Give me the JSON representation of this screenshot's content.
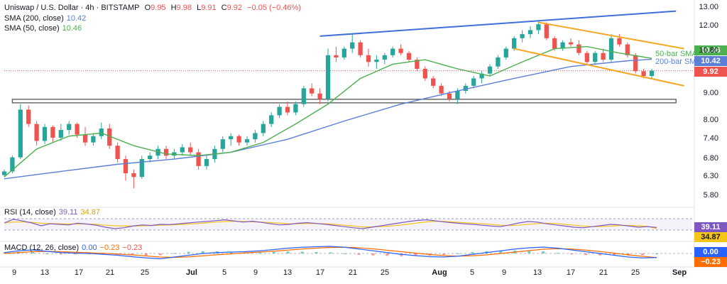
{
  "header": {
    "symbol": "Uniswap / U.S. Dollar · 4h · BITSTAMP",
    "o_label": "O",
    "o": "9.95",
    "h_label": "H",
    "h": "9.98",
    "l_label": "L",
    "l": "9.91",
    "c_label": "C",
    "c": "9.92",
    "change": "−0.05 (−0.46%)"
  },
  "indicators": {
    "sma200_label": "SMA (200, close)",
    "sma200_value": "10.42",
    "sma50_label": "SMA (50, close)",
    "sma50_value": "10.46",
    "rsi_label": "RSI (14, close)",
    "rsi_value": "39.11",
    "rsi_ma_value": "34.87",
    "macd_label": "MACD (12, 26, close)",
    "macd_value": "0.00",
    "macd_signal": "−0.23",
    "macd_hist": "−0.23"
  },
  "annotations": {
    "sma50_text": "50-bar SMA",
    "sma200_text": "200-bar SMA"
  },
  "price_tags": {
    "sma50": "10.46",
    "sma200": "10.42",
    "last": "9.92",
    "rsi": "39.11",
    "rsi_ma": "34.87",
    "macd": "0.00",
    "signal": "−0.23"
  },
  "colors": {
    "up": "#26a69a",
    "down": "#ef5350",
    "sma50": "#4caf50",
    "sma200": "#5b7fd6",
    "trend": "#3f6fd8",
    "channel": "#f5a623",
    "support": "#555555",
    "rsi": "#7e57c2",
    "rsi_ma": "#f5c518",
    "macd": "#2962ff",
    "signal": "#ff6d00"
  },
  "chart_data": {
    "type": "candlestick",
    "y_ticks": [
      "13.00",
      "12.00",
      "10.80",
      "9.00",
      "8.00",
      "7.40",
      "6.80",
      "6.30",
      "5.80"
    ],
    "y_axis": {
      "scale": "log",
      "range": [
        5.6,
        13.1
      ]
    },
    "x_ticks": [
      "9",
      "13",
      "17",
      "21",
      "25",
      "Jul",
      "5",
      "9",
      "13",
      "17",
      "21",
      "25",
      "Aug",
      "5",
      "9",
      "13",
      "17",
      "21",
      "25",
      "Sep"
    ],
    "x_axis": {
      "from": "2024-06-08",
      "to": "2024-09-01"
    },
    "candles": [
      [
        "2024-06-08",
        6.35,
        6.5,
        6.3,
        6.45
      ],
      [
        "2024-06-09",
        6.45,
        6.9,
        6.4,
        6.85
      ],
      [
        "2024-06-10",
        6.85,
        8.6,
        6.8,
        8.4
      ],
      [
        "2024-06-11",
        8.4,
        8.55,
        7.8,
        7.9
      ],
      [
        "2024-06-12",
        7.9,
        8.0,
        7.2,
        7.35
      ],
      [
        "2024-06-13",
        7.35,
        7.9,
        7.25,
        7.8
      ],
      [
        "2024-06-14",
        7.8,
        7.85,
        7.3,
        7.45
      ],
      [
        "2024-06-15",
        7.45,
        7.9,
        7.35,
        7.7
      ],
      [
        "2024-06-16",
        7.7,
        8.0,
        7.55,
        7.9
      ],
      [
        "2024-06-17",
        7.9,
        7.95,
        7.45,
        7.55
      ],
      [
        "2024-06-18",
        7.55,
        7.8,
        7.2,
        7.3
      ],
      [
        "2024-06-19",
        7.3,
        7.6,
        7.2,
        7.5
      ],
      [
        "2024-06-20",
        7.5,
        7.95,
        7.4,
        7.75
      ],
      [
        "2024-06-21",
        7.75,
        7.9,
        7.1,
        7.2
      ],
      [
        "2024-06-22",
        7.2,
        7.3,
        6.7,
        6.8
      ],
      [
        "2024-06-23",
        6.8,
        6.9,
        6.2,
        6.4
      ],
      [
        "2024-06-24",
        6.4,
        6.5,
        6.0,
        6.3
      ],
      [
        "2024-06-25",
        6.3,
        6.9,
        6.25,
        6.8
      ],
      [
        "2024-06-26",
        6.8,
        7.0,
        6.7,
        6.9
      ],
      [
        "2024-06-27",
        6.9,
        7.2,
        6.8,
        7.1
      ],
      [
        "2024-06-28",
        7.1,
        7.2,
        6.8,
        6.9
      ],
      [
        "2024-06-29",
        6.9,
        7.1,
        6.8,
        7.0
      ],
      [
        "2024-06-30",
        7.0,
        7.25,
        6.9,
        7.15
      ],
      [
        "2024-07-01",
        7.15,
        7.3,
        6.9,
        7.0
      ],
      [
        "2024-07-02",
        7.0,
        7.1,
        6.5,
        6.6
      ],
      [
        "2024-07-03",
        6.6,
        6.9,
        6.5,
        6.8
      ],
      [
        "2024-07-04",
        6.8,
        7.2,
        6.7,
        7.1
      ],
      [
        "2024-07-05",
        7.1,
        7.5,
        7.0,
        7.4
      ],
      [
        "2024-07-06",
        7.4,
        7.6,
        7.2,
        7.5
      ],
      [
        "2024-07-07",
        7.5,
        7.55,
        7.2,
        7.3
      ],
      [
        "2024-07-08",
        7.3,
        7.5,
        7.2,
        7.4
      ],
      [
        "2024-07-09",
        7.4,
        7.7,
        7.3,
        7.6
      ],
      [
        "2024-07-10",
        7.6,
        8.0,
        7.5,
        7.9
      ],
      [
        "2024-07-11",
        7.9,
        8.3,
        7.8,
        8.2
      ],
      [
        "2024-07-12",
        8.2,
        8.6,
        8.1,
        8.5
      ],
      [
        "2024-07-13",
        8.5,
        8.7,
        8.2,
        8.3
      ],
      [
        "2024-07-14",
        8.3,
        8.7,
        8.2,
        8.6
      ],
      [
        "2024-07-15",
        8.6,
        9.3,
        8.5,
        9.2
      ],
      [
        "2024-07-16",
        9.2,
        9.4,
        8.9,
        9.0
      ],
      [
        "2024-07-17",
        9.0,
        9.2,
        8.6,
        8.8
      ],
      [
        "2024-07-18",
        8.8,
        10.9,
        8.7,
        10.6
      ],
      [
        "2024-07-19",
        10.6,
        11.0,
        10.3,
        10.5
      ],
      [
        "2024-07-20",
        10.5,
        11.0,
        10.4,
        10.9
      ],
      [
        "2024-07-21",
        10.9,
        11.6,
        10.7,
        11.2
      ],
      [
        "2024-07-22",
        11.2,
        11.3,
        10.5,
        10.6
      ],
      [
        "2024-07-23",
        10.6,
        10.9,
        10.1,
        10.3
      ],
      [
        "2024-07-24",
        10.3,
        10.6,
        10.0,
        10.4
      ],
      [
        "2024-07-25",
        10.4,
        10.7,
        10.2,
        10.6
      ],
      [
        "2024-07-26",
        10.6,
        11.0,
        10.5,
        10.9
      ],
      [
        "2024-07-27",
        10.9,
        11.1,
        10.6,
        10.7
      ],
      [
        "2024-07-28",
        10.7,
        10.8,
        10.3,
        10.4
      ],
      [
        "2024-07-29",
        10.4,
        10.5,
        9.9,
        10.0
      ],
      [
        "2024-07-30",
        10.0,
        10.1,
        9.5,
        9.6
      ],
      [
        "2024-07-31",
        9.6,
        9.7,
        9.2,
        9.3
      ],
      [
        "2024-08-01",
        9.3,
        9.4,
        8.9,
        9.0
      ],
      [
        "2024-08-02",
        9.0,
        9.1,
        8.7,
        8.8
      ],
      [
        "2024-08-03",
        8.8,
        9.2,
        8.6,
        9.1
      ],
      [
        "2024-08-04",
        9.1,
        9.4,
        9.0,
        9.3
      ],
      [
        "2024-08-05",
        9.3,
        9.7,
        9.2,
        9.6
      ],
      [
        "2024-08-06",
        9.6,
        9.9,
        9.4,
        9.8
      ],
      [
        "2024-08-07",
        9.8,
        10.2,
        9.7,
        10.1
      ],
      [
        "2024-08-08",
        10.1,
        10.6,
        10.0,
        10.5
      ],
      [
        "2024-08-09",
        10.5,
        11.0,
        10.4,
        10.9
      ],
      [
        "2024-08-10",
        10.9,
        11.5,
        10.8,
        11.4
      ],
      [
        "2024-08-11",
        11.4,
        11.8,
        11.2,
        11.6
      ],
      [
        "2024-08-12",
        11.6,
        12.0,
        11.4,
        11.8
      ],
      [
        "2024-08-13",
        11.8,
        12.3,
        11.6,
        12.1
      ],
      [
        "2024-08-14",
        12.1,
        12.2,
        11.3,
        11.4
      ],
      [
        "2024-08-15",
        11.4,
        11.5,
        10.8,
        10.9
      ],
      [
        "2024-08-16",
        10.9,
        11.3,
        10.8,
        11.2
      ],
      [
        "2024-08-17",
        11.2,
        11.4,
        11.0,
        11.1
      ],
      [
        "2024-08-18",
        11.1,
        11.3,
        10.6,
        10.7
      ],
      [
        "2024-08-19",
        10.7,
        10.8,
        10.2,
        10.3
      ],
      [
        "2024-08-20",
        10.3,
        10.8,
        10.2,
        10.7
      ],
      [
        "2024-08-21",
        10.7,
        10.9,
        10.3,
        10.4
      ],
      [
        "2024-08-22",
        10.4,
        11.6,
        10.3,
        11.4
      ],
      [
        "2024-08-23",
        11.4,
        11.6,
        11.0,
        11.1
      ],
      [
        "2024-08-24",
        11.1,
        11.2,
        10.5,
        10.6
      ],
      [
        "2024-08-25",
        10.6,
        10.7,
        9.8,
        9.9
      ],
      [
        "2024-08-26",
        9.9,
        10.0,
        9.6,
        9.7
      ],
      [
        "2024-08-27",
        9.7,
        10.0,
        9.6,
        9.92
      ]
    ],
    "sma50": [
      [
        "2024-06-08",
        6.3
      ],
      [
        "2024-06-12",
        7.1
      ],
      [
        "2024-06-16",
        7.5
      ],
      [
        "2024-06-20",
        7.6
      ],
      [
        "2024-06-24",
        7.2
      ],
      [
        "2024-06-28",
        6.95
      ],
      [
        "2024-07-02",
        6.9
      ],
      [
        "2024-07-06",
        7.0
      ],
      [
        "2024-07-10",
        7.3
      ],
      [
        "2024-07-14",
        7.9
      ],
      [
        "2024-07-18",
        8.6
      ],
      [
        "2024-07-22",
        9.6
      ],
      [
        "2024-07-26",
        10.2
      ],
      [
        "2024-07-30",
        10.4
      ],
      [
        "2024-08-03",
        10.0
      ],
      [
        "2024-08-07",
        9.7
      ],
      [
        "2024-08-11",
        10.3
      ],
      [
        "2024-08-15",
        10.9
      ],
      [
        "2024-08-19",
        11.0
      ],
      [
        "2024-08-23",
        10.7
      ],
      [
        "2024-08-27",
        10.46
      ]
    ],
    "sma200": [
      [
        "2024-06-08",
        6.25
      ],
      [
        "2024-06-15",
        6.45
      ],
      [
        "2024-06-22",
        6.65
      ],
      [
        "2024-06-29",
        6.8
      ],
      [
        "2024-07-06",
        7.0
      ],
      [
        "2024-07-13",
        7.4
      ],
      [
        "2024-07-20",
        8.0
      ],
      [
        "2024-07-27",
        8.6
      ],
      [
        "2024-08-03",
        9.1
      ],
      [
        "2024-08-10",
        9.6
      ],
      [
        "2024-08-17",
        10.1
      ],
      [
        "2024-08-24",
        10.35
      ],
      [
        "2024-08-27",
        10.42
      ]
    ],
    "trendlines": [
      {
        "kind": "resistance",
        "from": [
          "2024-07-17",
          11.5
        ],
        "to": [
          "2024-08-30",
          12.8
        ]
      },
      {
        "kind": "channel-top",
        "from": [
          "2024-08-13",
          12.2
        ],
        "to": [
          "2024-08-31",
          10.9
        ]
      },
      {
        "kind": "channel-bottom",
        "from": [
          "2024-08-10",
          10.9
        ],
        "to": [
          "2024-08-31",
          9.3
        ]
      },
      {
        "kind": "support",
        "from": [
          "2024-06-09",
          8.7
        ],
        "to": [
          "2024-08-30",
          8.7
        ]
      }
    ],
    "rsi": {
      "range": [
        0,
        100
      ],
      "levels": [
        70,
        30
      ],
      "values": [
        55,
        68,
        62,
        55,
        45,
        52,
        50,
        48,
        54,
        51,
        47,
        40,
        35,
        38,
        44,
        48,
        46,
        50,
        49,
        52,
        55,
        58,
        60,
        63,
        66,
        62,
        58,
        61,
        57,
        52,
        48,
        50,
        54,
        56,
        53,
        50,
        46,
        42,
        38,
        35,
        40,
        45,
        50,
        55,
        60,
        64,
        66,
        62,
        58,
        55,
        52,
        50,
        47,
        44,
        42,
        48,
        55,
        60,
        58,
        52,
        48,
        44,
        40,
        38,
        42,
        46,
        50,
        48,
        44,
        40,
        42,
        39.11
      ],
      "ma": [
        55,
        58,
        59,
        57,
        54,
        53,
        52,
        51,
        52,
        51,
        50,
        47,
        45,
        44,
        44,
        45,
        46,
        47,
        48,
        49,
        51,
        53,
        55,
        58,
        60,
        61,
        60,
        59,
        58,
        56,
        54,
        52,
        52,
        53,
        53,
        52,
        50,
        47,
        44,
        41,
        41,
        42,
        44,
        47,
        51,
        55,
        59,
        61,
        60,
        58,
        56,
        54,
        52,
        50,
        47,
        46,
        47,
        50,
        53,
        54,
        53,
        50,
        47,
        44,
        42,
        42,
        44,
        46,
        46,
        45,
        43,
        34.87
      ]
    },
    "macd": {
      "zero": true,
      "macd": [
        0.05,
        0.15,
        0.2,
        0.12,
        0.05,
        0.02,
        0.0,
        -0.05,
        -0.1,
        -0.18,
        -0.25,
        -0.3,
        -0.2,
        -0.1,
        0.0,
        0.05,
        0.08,
        0.1,
        0.15,
        0.22,
        0.3,
        0.35,
        0.38,
        0.4,
        0.35,
        0.25,
        0.15,
        0.05,
        -0.05,
        -0.12,
        -0.18,
        -0.2,
        -0.15,
        -0.05,
        0.05,
        0.15,
        0.25,
        0.32,
        0.36,
        0.3,
        0.2,
        0.1,
        0.0,
        -0.1,
        -0.2,
        -0.25,
        -0.23
      ],
      "signal": [
        0.0,
        0.05,
        0.1,
        0.12,
        0.1,
        0.07,
        0.04,
        0.01,
        -0.03,
        -0.08,
        -0.14,
        -0.2,
        -0.22,
        -0.19,
        -0.13,
        -0.07,
        -0.02,
        0.03,
        0.08,
        0.13,
        0.19,
        0.25,
        0.3,
        0.34,
        0.35,
        0.32,
        0.26,
        0.18,
        0.1,
        0.02,
        -0.06,
        -0.12,
        -0.15,
        -0.13,
        -0.08,
        0.0,
        0.08,
        0.16,
        0.24,
        0.27,
        0.25,
        0.19,
        0.11,
        0.02,
        -0.08,
        -0.16,
        -0.23
      ]
    }
  }
}
